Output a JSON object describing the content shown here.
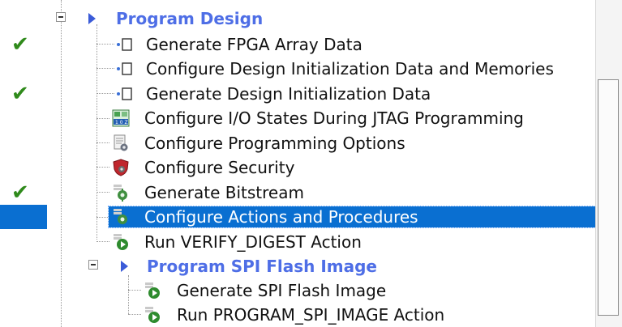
{
  "tree": {
    "groups": {
      "program_design": "Program Design",
      "program_spi_flash_image": "Program SPI Flash Image"
    },
    "items": [
      {
        "label": "Generate FPGA Array Data",
        "status": "done",
        "icon": "task-square-icon"
      },
      {
        "label": "Configure Design Initialization Data and Memories",
        "status": "",
        "icon": "task-square-icon"
      },
      {
        "label": "Generate Design Initialization Data",
        "status": "done",
        "icon": "task-square-icon"
      },
      {
        "label": "Configure I/O States During JTAG Programming",
        "status": "",
        "icon": "io-states-icon"
      },
      {
        "label": "Configure Programming Options",
        "status": "",
        "icon": "programming-options-icon"
      },
      {
        "label": "Configure Security",
        "status": "",
        "icon": "security-shield-icon"
      },
      {
        "label": "Generate Bitstream",
        "status": "done",
        "icon": "bitstream-gear-icon"
      },
      {
        "label": "Configure Actions and Procedures",
        "status": "",
        "icon": "actions-procedures-icon",
        "selected": true
      },
      {
        "label": "Run VERIFY_DIGEST Action",
        "status": "",
        "icon": "run-action-icon"
      },
      {
        "label": "Generate SPI Flash Image",
        "status": "",
        "icon": "run-action-icon"
      },
      {
        "label": "Run PROGRAM_SPI_IMAGE Action",
        "status": "",
        "icon": "run-action-icon"
      }
    ]
  },
  "colors": {
    "selection": "#0a6fd1",
    "group_text": "#4e6ee6",
    "check": "#2f8a1b"
  }
}
